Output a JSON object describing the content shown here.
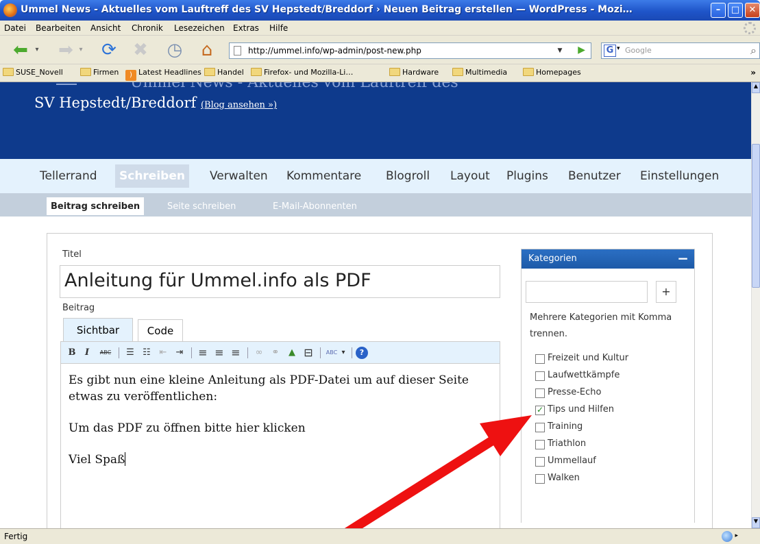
{
  "window": {
    "title": "Ummel News - Aktuelles vom Lauftreff des SV Hepstedt/Breddorf › Neuen Beitrag erstellen — WordPress - Mozi…",
    "min_label": "–",
    "max_label": "□",
    "close_label": "✕"
  },
  "menubar": {
    "items": [
      "Datei",
      "Bearbeiten",
      "Ansicht",
      "Chronik",
      "Lesezeichen",
      "Extras",
      "Hilfe"
    ]
  },
  "navbar": {
    "back_glyph": "⬅",
    "drop_glyph": "▾",
    "forward_glyph": "➡",
    "reload_glyph": "⟳",
    "stop_glyph": "✖",
    "history_glyph": "◷",
    "home_glyph": "⌂",
    "url": "http://ummel.info/wp-admin/post-new.php",
    "url_drop_glyph": "▼",
    "go_glyph": "▶",
    "search_engine_glyph": "G",
    "search_placeholder": "Google",
    "search_glyph": "⌕"
  },
  "bookmarks": {
    "items": [
      "SUSE_Novell",
      "Firmen",
      "Latest Headlines",
      "Handel",
      "Firefox- und Mozilla-Li…",
      "Hardware",
      "Multimedia",
      "Homepages"
    ],
    "more_glyph": "»"
  },
  "wp": {
    "header_cut": "Ummel News - Aktuelles vom Lauftreff des",
    "blog_name": "SV Hepstedt/Breddorf",
    "blog_link": "(Blog ansehen »)",
    "menu": [
      "Tellerrand",
      "Schreiben",
      "Verwalten",
      "Kommentare",
      "Blogroll",
      "Layout",
      "Plugins",
      "Benutzer",
      "Einstellungen"
    ],
    "submenu": [
      "Beitrag schreiben",
      "Seite schreiben",
      "E-Mail-Abonnenten"
    ],
    "title_label": "Titel",
    "post_title": "Anleitung für Ummel.info als PDF",
    "content_label": "Beitrag",
    "tab_visual": "Sichtbar",
    "tab_code": "Code",
    "toolbar": {
      "bold": "B",
      "italic": "I",
      "strike": "ABC",
      "ul": "☰",
      "ol": "☷",
      "outdent": "⇤",
      "indent": "⇥",
      "align_left": "≡",
      "align_center": "≡",
      "align_right": "≡",
      "link": "∞",
      "unlink": "⚭",
      "image": "▲",
      "more": "⊟",
      "spell": "ABC",
      "spell_drop": "▾",
      "help": "?"
    },
    "content": [
      "Es gibt nun eine kleine Anleitung als PDF-Datei um auf dieser Seite etwas zu veröffentlichen:",
      "Um das PDF zu öffnen bitte hier klicken",
      "Viel Spaß"
    ],
    "categories": {
      "title": "Kategorien",
      "collapse": "−",
      "add_label": "+",
      "hint": "Mehrere Kategorien mit Komma trennen.",
      "items": [
        {
          "name": "Freizeit und Kultur",
          "checked": false
        },
        {
          "name": "Laufwettkämpfe",
          "checked": false
        },
        {
          "name": "Presse-Echo",
          "checked": false
        },
        {
          "name": "Tips und Hilfen",
          "checked": true
        },
        {
          "name": "Training",
          "checked": false
        },
        {
          "name": "Triathlon",
          "checked": false
        },
        {
          "name": "Ummellauf",
          "checked": false
        },
        {
          "name": "Walken",
          "checked": false
        }
      ]
    }
  },
  "scrollbar": {
    "up_glyph": "▲",
    "down_glyph": "▼"
  },
  "status": {
    "text": "Fertig",
    "drop_glyph": "▸"
  },
  "colors": {
    "arrow": "#ee1111",
    "wp_header": "#0e3a8c"
  }
}
